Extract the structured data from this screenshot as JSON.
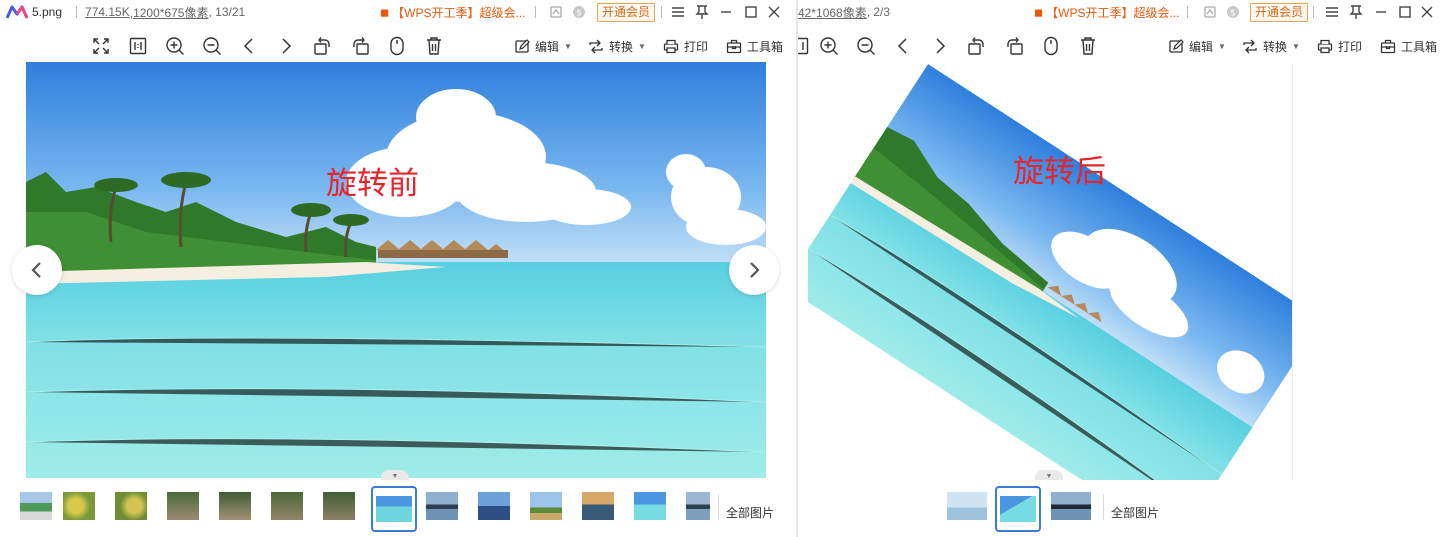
{
  "left": {
    "title": {
      "filename": "5.png",
      "filesize": "774.15K",
      "dimensions": ",1200*675像素",
      "index": ", 13/21"
    },
    "promo_text": "【WPS开工季】超级会...",
    "vip_label": "开通会员",
    "toolbar": {
      "edit_label": "编辑",
      "convert_label": "转换",
      "print_label": "打印",
      "toolbox_label": "工具箱"
    },
    "caption": "旋转前",
    "all_pictures_label": "全部图片"
  },
  "right": {
    "title": {
      "info": "42*1068像素",
      "index": ", 2/3"
    },
    "promo_text": "【WPS开工季】超级会...",
    "vip_label": "开通会员",
    "toolbar": {
      "edit_label": "编辑",
      "convert_label": "转换",
      "print_label": "打印",
      "toolbox_label": "工具箱"
    },
    "caption": "旋转后",
    "all_pictures_label": "全部图片"
  },
  "colors": {
    "accent": "#3a7bd5",
    "caption_red": "#e8242b",
    "promo_orange": "#e8590c",
    "vip_border": "#e9a35a"
  }
}
